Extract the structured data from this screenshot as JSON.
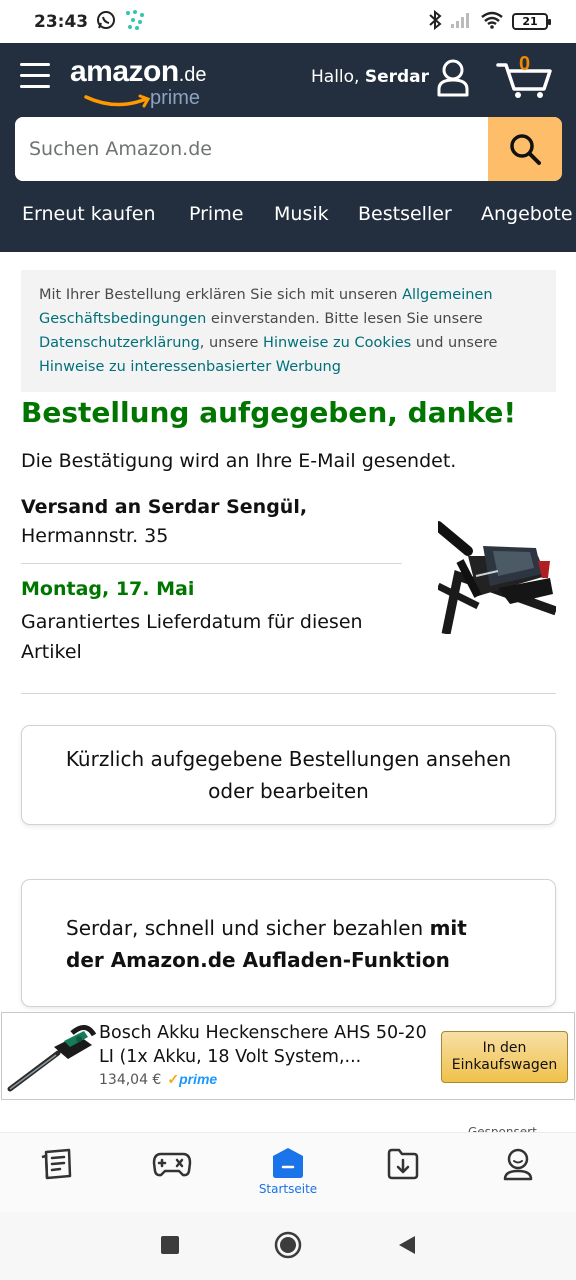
{
  "status_bar": {
    "time": "23:43",
    "battery": "21",
    "icons": [
      "whatsapp-icon",
      "app-notification-icon",
      "bluetooth-icon",
      "signal-icon",
      "wifi-icon",
      "battery-icon"
    ]
  },
  "header": {
    "logo_text": "amazon",
    "logo_tld": ".de",
    "logo_sub": "prime",
    "greeting_prefix": "Hallo, ",
    "greeting_name": "Serdar",
    "cart_count": "0",
    "search_placeholder": "Suchen Amazon.de",
    "nav_links": [
      "Erneut kaufen",
      "Prime",
      "Musik",
      "Bestseller",
      "Angebote"
    ],
    "colors": {
      "header_bg": "#232f3e",
      "search_button": "#febd69",
      "cart_count": "#f08804"
    }
  },
  "legal": {
    "t1": "Mit Ihrer Bestellung erklären Sie sich mit unseren ",
    "l1": "Allgemeinen Geschäftsbedingungen",
    "t2": " einverstanden. Bitte lesen Sie unsere ",
    "l2": "Datenschutzerklärung",
    "t3": ", unsere ",
    "l3": "Hinweise zu Cookies",
    "t4": " und unsere ",
    "l4": "Hinweise zu interessenbasierter Werbung"
  },
  "order": {
    "heading": "Bestellung aufgegeben, danke!",
    "confirmation": "Die Bestätigung wird an Ihre E-Mail gesendet.",
    "ship_to": "Versand an Serdar Sengül,",
    "address": "Hermannstr. 35",
    "delivery_date": "Montag, 17. Mai",
    "delivery_note": "Garantiertes Lieferdatum für diesen Artikel",
    "heading_color": "#007600"
  },
  "buttons": {
    "view_orders": "Kürzlich aufgegebene Bestellungen ansehen oder bearbeiten"
  },
  "promo": {
    "text_plain": "Serdar, schnell und sicher bezahlen ",
    "text_bold": "mit der Amazon.de Aufladen-Funktion"
  },
  "ad": {
    "title": "Bosch Akku Heckenschere AHS 50-20 LI (1x Akku, 18 Volt System,...",
    "price": "134,04 €",
    "prime_label": "prime",
    "cta": "In den Einkaufswagen"
  },
  "partial_text": "Gesponsert",
  "bottom_nav": {
    "items": [
      {
        "icon": "news-icon"
      },
      {
        "icon": "gamepad-icon"
      },
      {
        "icon": "home-icon",
        "label": "Startseite",
        "active": true
      },
      {
        "icon": "download-icon"
      },
      {
        "icon": "profile-icon"
      }
    ],
    "active_color": "#1a73e8"
  },
  "system_nav": [
    "recents-icon",
    "home-circle-icon",
    "back-icon"
  ]
}
